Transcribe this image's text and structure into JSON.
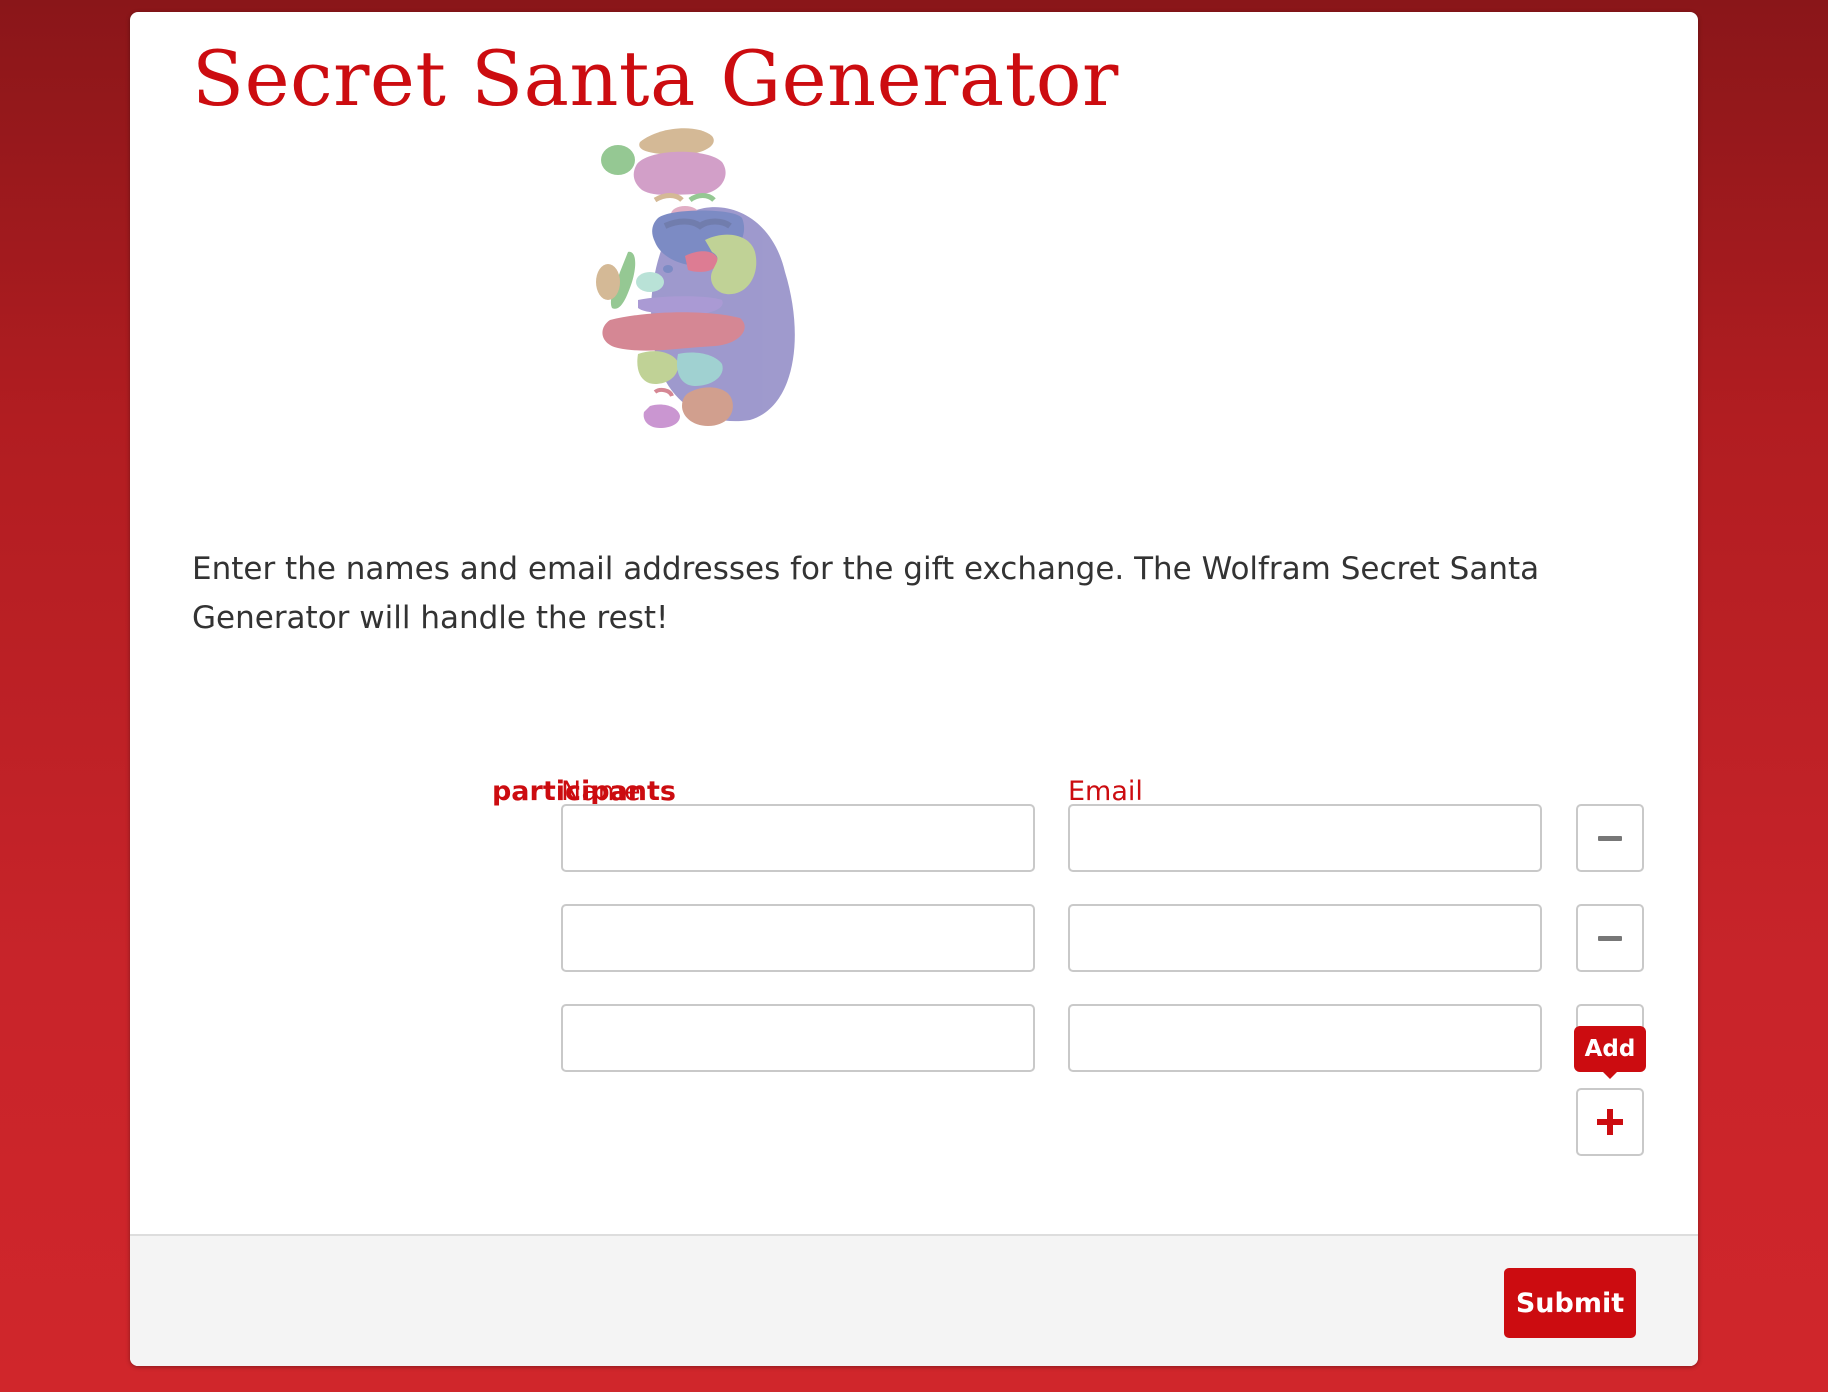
{
  "page": {
    "title": "Secret Santa Generator",
    "intro": "Enter the names and email addresses for the gift exchange. The Wolfram Secret Santa Generator will handle the rest!"
  },
  "form": {
    "field_label": "participants",
    "name_header": "Name",
    "email_header": "Email",
    "rows": [
      {
        "name": "",
        "email": "",
        "action": "remove"
      },
      {
        "name": "",
        "email": "",
        "action": "remove"
      },
      {
        "name": "",
        "email": "",
        "action": "remove"
      }
    ],
    "add_tooltip": "Add",
    "add_icon": "plus-icon",
    "remove_icon": "minus-icon"
  },
  "footer": {
    "submit_label": "Submit"
  },
  "colors": {
    "accent": "#cc0c10",
    "background": "#c8242a",
    "card": "#ffffff",
    "footer": "#f4f4f4"
  }
}
